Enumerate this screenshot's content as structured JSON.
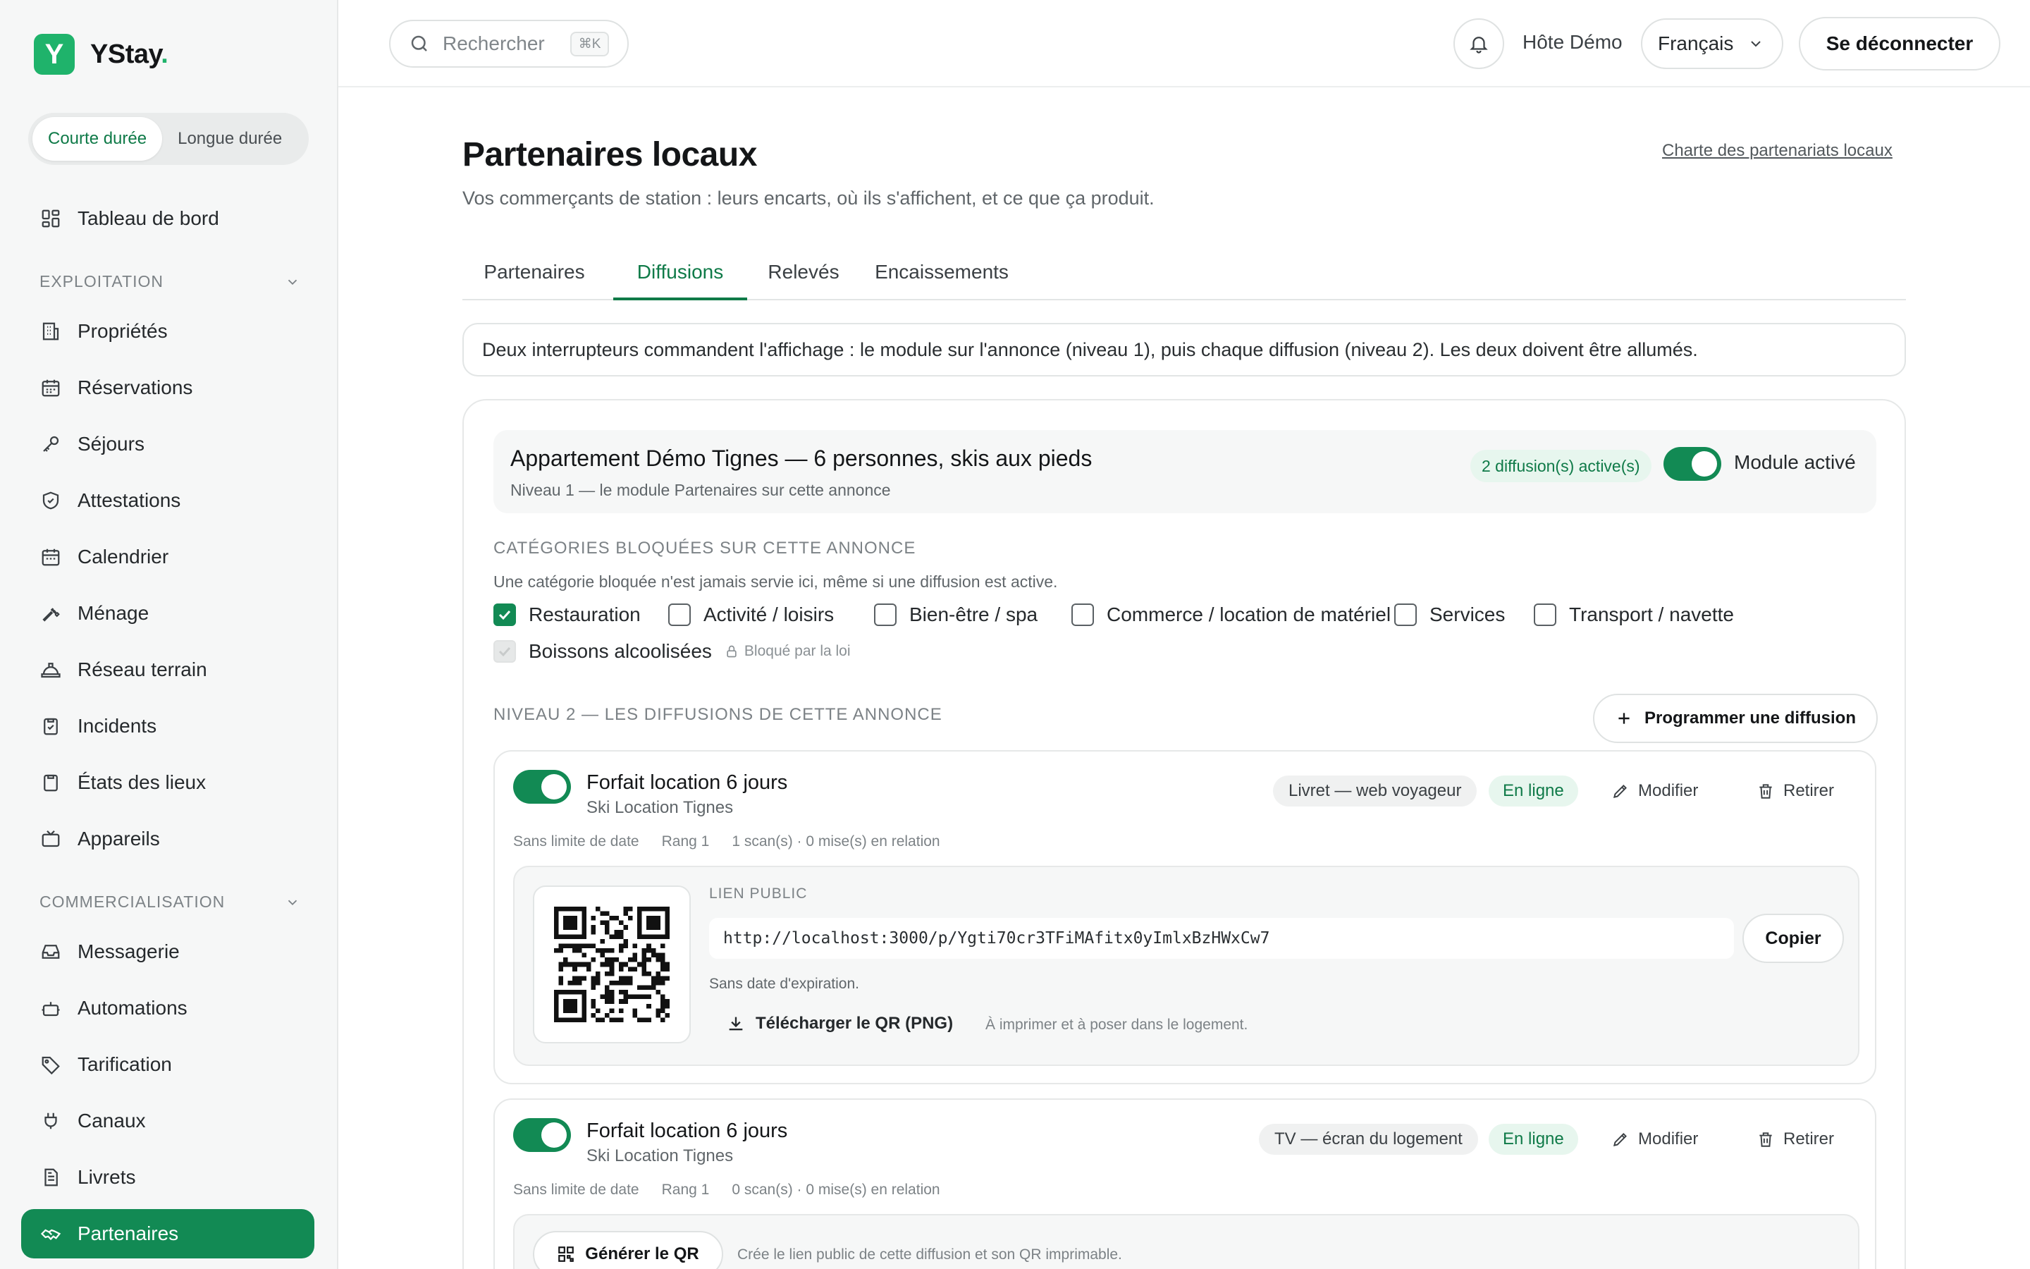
{
  "brand": {
    "logo_letter": "Y",
    "name": "YStay",
    "dot": ".",
    "accent": "#1fb36b"
  },
  "duration_toggle": {
    "short": "Courte durée",
    "long": "Longue durée",
    "selected": "Courte durée"
  },
  "sidebar": {
    "dashboard": {
      "label": "Tableau de bord",
      "icon": "dashboard-icon"
    },
    "section_exploitation": "EXPLOITATION",
    "exploitation": [
      {
        "label": "Propriétés",
        "icon": "building-icon"
      },
      {
        "label": "Réservations",
        "icon": "calendar-icon"
      },
      {
        "label": "Séjours",
        "icon": "key-icon"
      },
      {
        "label": "Attestations",
        "icon": "shield-icon"
      },
      {
        "label": "Calendrier",
        "icon": "calendar-icon"
      },
      {
        "label": "Ménage",
        "icon": "wrench-icon"
      },
      {
        "label": "Réseau terrain",
        "icon": "helmet-icon"
      },
      {
        "label": "Incidents",
        "icon": "clipboard-check-icon"
      },
      {
        "label": "États des lieux",
        "icon": "clipboard-icon"
      },
      {
        "label": "Appareils",
        "icon": "tv-icon"
      }
    ],
    "section_commercial": "COMMERCIALISATION",
    "commercial": [
      {
        "label": "Messagerie",
        "icon": "inbox-icon"
      },
      {
        "label": "Automations",
        "icon": "robot-icon"
      },
      {
        "label": "Tarification",
        "icon": "tag-icon"
      },
      {
        "label": "Canaux",
        "icon": "plug-icon"
      },
      {
        "label": "Livrets",
        "icon": "document-icon"
      },
      {
        "label": "Partenaires",
        "icon": "handshake-icon",
        "active": true
      }
    ]
  },
  "topbar": {
    "search_placeholder": "Rechercher",
    "shortcut": "⌘K",
    "host": "Hôte Démo",
    "language": "Français",
    "logout": "Se déconnecter"
  },
  "page": {
    "title": "Partenaires locaux",
    "subtitle": "Vos commerçants de station : leurs encarts, où ils s'affichent, et ce que ça produit.",
    "charter_link": "Charte des partenariats locaux",
    "tabs": [
      "Partenaires",
      "Diffusions",
      "Relevés",
      "Encaissements"
    ],
    "active_tab": "Diffusions",
    "info": "Deux interrupteurs commandent l'affichage : le module sur l'annonce (niveau 1), puis chaque diffusion (niveau 2). Les deux doivent être allumés."
  },
  "listing": {
    "title": "Appartement Démo Tignes — 6 personnes, skis aux pieds",
    "subtitle": "Niveau 1 — le module Partenaires sur cette annonce",
    "active_count": "2 diffusion(s) active(s)",
    "module_label": "Module activé",
    "module_on": true
  },
  "blocked": {
    "heading": "CATÉGORIES BLOQUÉES SUR CETTE ANNONCE",
    "description": "Une catégorie bloquée n'est jamais servie ici, même si une diffusion est active.",
    "categories": [
      {
        "label": "Restauration",
        "checked": true
      },
      {
        "label": "Activité / loisirs",
        "checked": false
      },
      {
        "label": "Bien-être / spa",
        "checked": false
      },
      {
        "label": "Commerce / location de matériel",
        "checked": false
      },
      {
        "label": "Services",
        "checked": false
      },
      {
        "label": "Transport / navette",
        "checked": false
      },
      {
        "label": "Boissons alcoolisées",
        "checked": true,
        "disabled": true,
        "note": "Bloqué par la loi"
      }
    ]
  },
  "level2": {
    "heading": "NIVEAU 2 — LES DIFFUSIONS DE CETTE ANNONCE",
    "program_button": "Programmer une diffusion"
  },
  "diffusions": [
    {
      "title": "Forfait location 6 jours",
      "partner": "Ski Location Tignes",
      "channel": "Livret — web voyageur",
      "status": "En ligne",
      "edit": "Modifier",
      "remove": "Retirer",
      "date": "Sans limite de date",
      "rank": "Rang 1",
      "stats": "1 scan(s) · 0 mise(s) en relation",
      "public_link_label": "LIEN PUBLIC",
      "url": "http://localhost:3000/p/Ygti70cr3TFiMAfitx0yImlxBzHWxCw7",
      "copy": "Copier",
      "expiry": "Sans date d'expiration.",
      "download": "Télécharger le QR (PNG)",
      "download_hint": "À imprimer et à poser dans le logement."
    },
    {
      "title": "Forfait location 6 jours",
      "partner": "Ski Location Tignes",
      "channel": "TV — écran du logement",
      "status": "En ligne",
      "edit": "Modifier",
      "remove": "Retirer",
      "date": "Sans limite de date",
      "rank": "Rang 1",
      "stats": "0 scan(s) · 0 mise(s) en relation",
      "generate": "Générer le QR",
      "generate_hint": "Crée le lien public de cette diffusion et son QR imprimable."
    }
  ]
}
